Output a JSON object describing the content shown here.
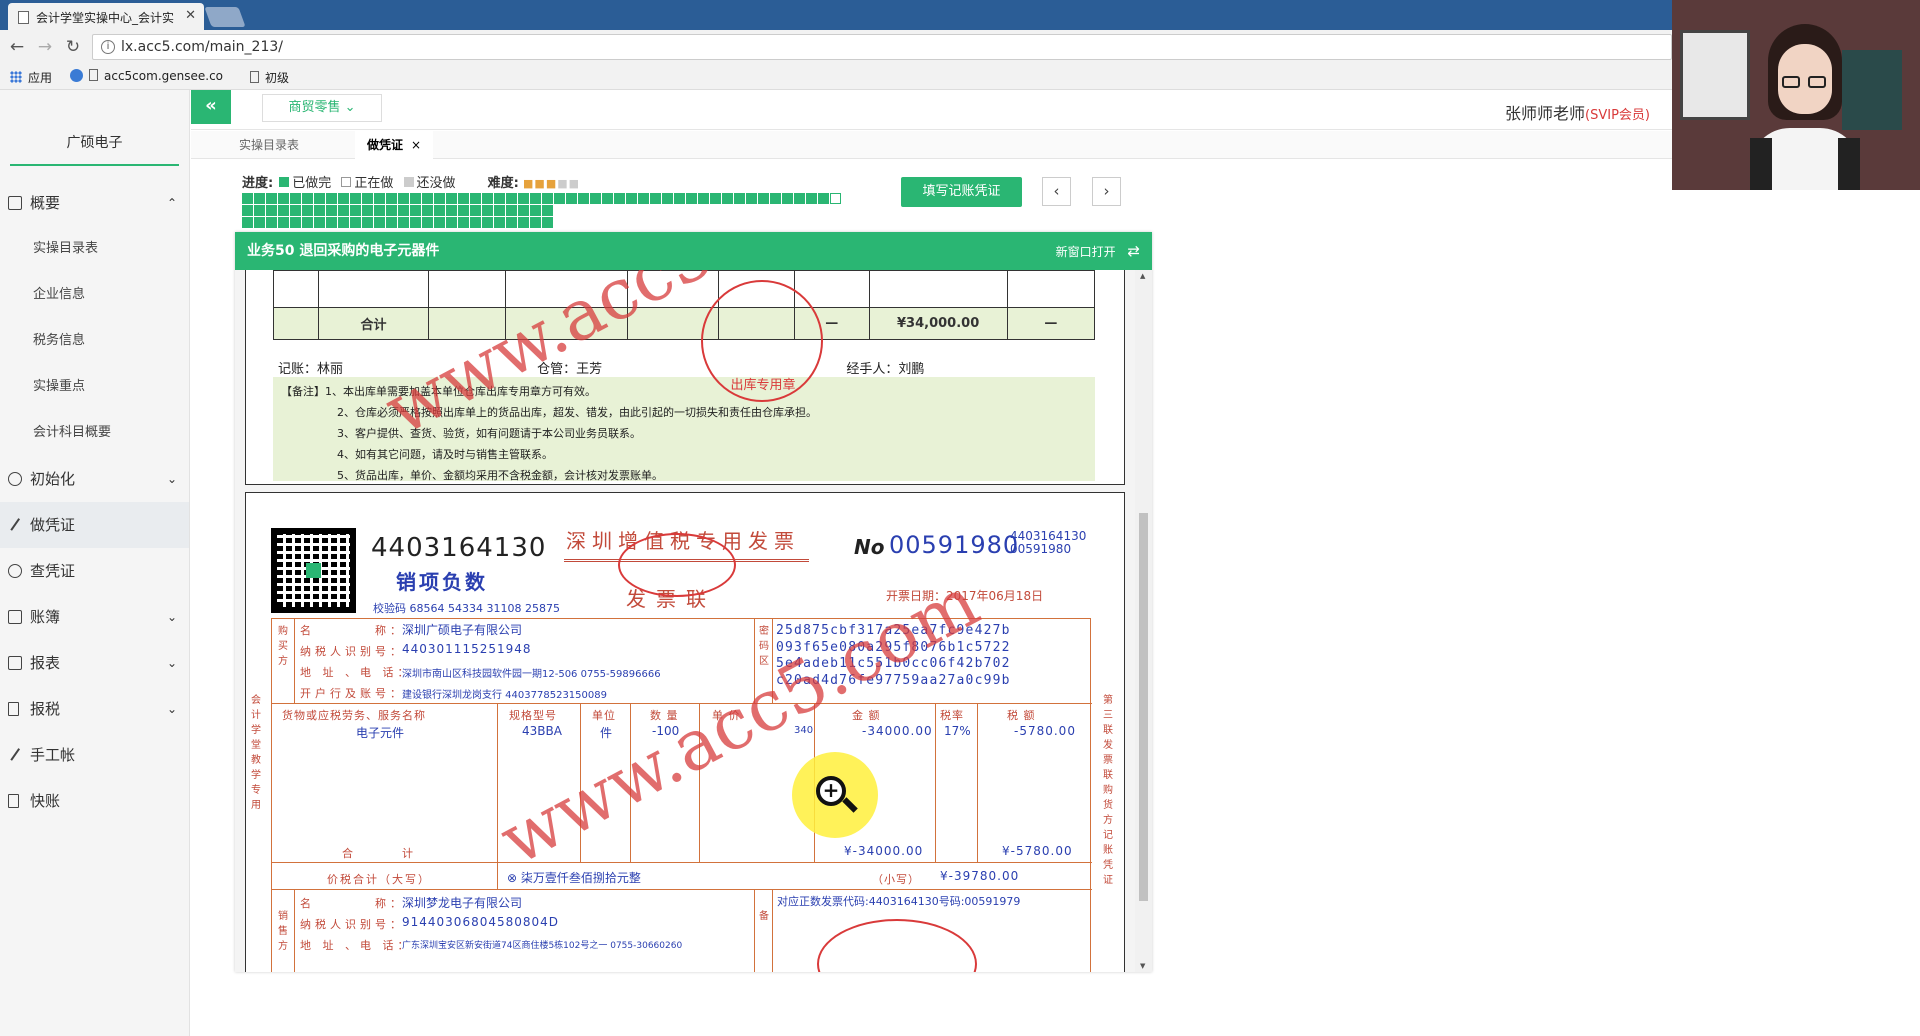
{
  "browser": {
    "tab_title": "会计学堂实操中心_会计实",
    "url": "lx.acc5.com/main_213/",
    "bookmarks": [
      "应用",
      "acc5com.gensee.co",
      "初级"
    ]
  },
  "app": {
    "company": "广硕电子",
    "dropdown": "商贸零售",
    "user": "张师师老师",
    "vip": "(SVIP会员)",
    "tabs": [
      {
        "label": "实操目录表"
      },
      {
        "label": "做凭证",
        "close": "×"
      }
    ],
    "menu": {
      "overview": "概要",
      "sub": [
        "实操目录表",
        "企业信息",
        "税务信息",
        "实操重点",
        "会计科目概要"
      ],
      "init": "初始化",
      "voucher": "做凭证",
      "query": "查凭证",
      "ledger": "账簿",
      "report": "报表",
      "tax": "报税",
      "manual": "手工帐",
      "quick": "快账"
    }
  },
  "progress": {
    "label": "进度:",
    "legend_done": "已做完",
    "legend_doing": "正在做",
    "legend_todo": "还没做",
    "difficulty_label": "难度:",
    "difficulty": 3,
    "difficulty_max": 5,
    "fill_button": "填写记账凭证",
    "prev": "‹",
    "next": "›"
  },
  "panel": {
    "title": "业务50 退回采购的电子元器件",
    "open_new": "新窗口打开"
  },
  "delivery_note": {
    "total_label": "合计",
    "dash1": "—",
    "amount": "¥34,000.00",
    "dash2": "—",
    "bookkeeper": "记账：林丽",
    "warehouse": "仓管：王芳",
    "handler": "经手人：刘鹏",
    "notes": [
      "【备注】1、本出库单需要加盖本单位仓库出库专用章方可有效。",
      "2、仓库必须严格按照出库单上的货品出库，超发、错发，由此引起的一切损失和责任由仓库承担。",
      "3、客户提供、查货、验货，如有问题请于本公司业务员联系。",
      "4、如有其它问题，请及时与销售主管联系。",
      "5、货品出库，单价、金额均采用不含税金额，会计核对发票账单。"
    ],
    "stamp": "出库专用章"
  },
  "invoice": {
    "code": "4403164130",
    "kind": "销项负数",
    "verify": "校验码 68564 54334 31108 25875",
    "title": "深圳增值税专用发票",
    "sub": "发票联",
    "no_label": "No",
    "number": "00591980",
    "code_small": "4403164130",
    "number_small": "00591980",
    "date": "开票日期：2017年06月18日",
    "buyer_name_lbl": "名　　　　称：",
    "buyer_name": "深圳广硕电子有限公司",
    "buyer_tax_lbl": "纳税人识别号：",
    "buyer_tax": "440301115251948",
    "buyer_addr_lbl": "地 址 、电 话：",
    "buyer_addr": "深圳市南山区科技园软件园一期12-506 0755-59896666",
    "buyer_bank_lbl": "开户行及账号：",
    "buyer_bank": "建设银行深圳龙岗支行 4403778523150089",
    "cipher": [
      "25d875cbf317a25ea7fc9e427b",
      "093f65e080a295f8076b1c5722",
      "5e4adeb11c551b0cc06f42b702",
      "c20ad4d76fe97759aa27a0c99b"
    ],
    "col_goods": "货物或应税劳务、服务名称",
    "col_spec": "规格型号",
    "col_unit": "单位",
    "col_qty": "数 量",
    "col_price": "单 价",
    "col_amount": "金 额",
    "col_rate": "税率",
    "col_tax": "税 额",
    "item_name": "电子元件",
    "item_spec": "43BBA",
    "item_unit": "件",
    "item_qty": "-100",
    "item_price": "340",
    "item_amount": "-34000.00",
    "item_rate": "17%",
    "item_tax": "-5780.00",
    "sum_label": "合　　　计",
    "sum_amount": "¥-34000.00",
    "sum_tax": "¥-5780.00",
    "total_label": "价税合计（大写）",
    "total_cn": "⊗ 柒万壹仟叁佰捌拾元整",
    "total_small_lbl": "（小写）",
    "total_small": "¥-39780.00",
    "seller_name": "深圳梦龙电子有限公司",
    "seller_tax": "91440306804580804D",
    "seller_addr": "广东深圳宝安区新安街道74区商住楼5栋102号之一 0755-30660260",
    "remark": "对应正数发票代码:4403164130号码:00591979",
    "side_left": "会计学堂教学专用",
    "side_right": "第三联 发票联 购货方记账凭证",
    "buyer_side": "购买方",
    "seller_side": "销售方",
    "cipher_side": "密码区",
    "remark_side": "备"
  },
  "watermark": "www.acc5.com",
  "colors": {
    "accent": "#2ab673",
    "invoice_red": "#c24a3a",
    "invoice_blue": "#2a3fb0"
  }
}
